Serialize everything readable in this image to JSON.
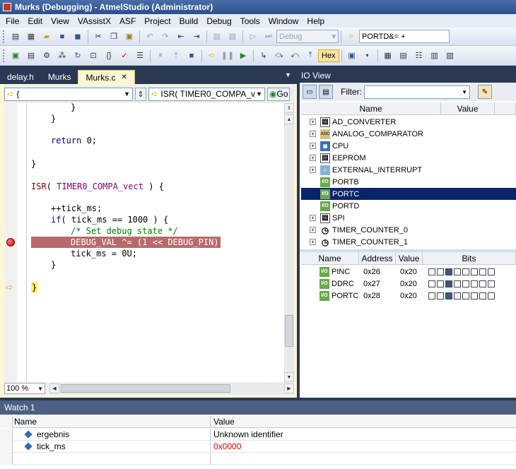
{
  "window": {
    "title": "Murks (Debugging) - AtmelStudio (Administrator)"
  },
  "menu": [
    "File",
    "Edit",
    "View",
    "VAssistX",
    "ASF",
    "Project",
    "Build",
    "Debug",
    "Tools",
    "Window",
    "Help"
  ],
  "toolbar1": {
    "config_combo": "Debug",
    "find_combo": "PORTD&= +"
  },
  "toolbar2": {
    "hex_label": "Hex"
  },
  "editor": {
    "tabs": [
      {
        "label": "delay.h"
      },
      {
        "label": "Murks"
      },
      {
        "label": "Murks.c"
      }
    ],
    "nav_scope": "{",
    "nav_member": "ISR( TIMER0_COMPA_v",
    "go_label": "Go",
    "zoom": "100 %",
    "code": {
      "l1": "}",
      "l2": "}",
      "l3_kw": "return",
      "l3_rest": " 0;",
      "l4": "}",
      "l5_fn": "ISR",
      "l5_p": "( ",
      "l5_mac": "TIMER0_COMPA_vect",
      "l5_rest": " ) {",
      "l6": "++tick_ms;",
      "l7_kw": "if",
      "l7_rest": "( tick_ms == 1000 ) {",
      "l8": "/* Set debug state */",
      "l9": "DEBUG_VAL ^= (1 << DEBUG_PIN);",
      "l10": "tick_ms = 0U;",
      "l11": "}",
      "l12": "}"
    }
  },
  "io_view": {
    "title": "IO View",
    "filter_label": "Filter:",
    "columns": {
      "name": "Name",
      "value": "Value"
    },
    "modules": [
      {
        "name": "AD_CONVERTER",
        "icon": "adc-icon",
        "expandable": true
      },
      {
        "name": "ANALOG_COMPARATOR",
        "icon": "analog-comparator-icon",
        "expandable": true
      },
      {
        "name": "CPU",
        "icon": "cpu-icon",
        "expandable": true
      },
      {
        "name": "EEPROM",
        "icon": "eeprom-icon",
        "expandable": true
      },
      {
        "name": "EXTERNAL_INTERRUPT",
        "icon": "interrupt-icon",
        "expandable": true
      },
      {
        "name": "PORTB",
        "icon": "io-port-icon",
        "expandable": false
      },
      {
        "name": "PORTC",
        "icon": "io-port-icon",
        "expandable": false,
        "selected": true
      },
      {
        "name": "PORTD",
        "icon": "io-port-icon",
        "expandable": false
      },
      {
        "name": "SPI",
        "icon": "spi-icon",
        "expandable": true
      },
      {
        "name": "TIMER_COUNTER_0",
        "icon": "timer-icon",
        "expandable": true
      },
      {
        "name": "TIMER_COUNTER_1",
        "icon": "timer-icon",
        "expandable": true
      }
    ],
    "io_badge": "I/O",
    "adc_badge": "ADC",
    "reg_columns": {
      "name": "Name",
      "address": "Address",
      "value": "Value",
      "bits": "Bits"
    },
    "registers": [
      {
        "name": "PINC",
        "address": "0x26",
        "value": "0x20",
        "bits": [
          0,
          0,
          1,
          0,
          0,
          0,
          0,
          0
        ]
      },
      {
        "name": "DDRC",
        "address": "0x27",
        "value": "0x20",
        "bits": [
          0,
          0,
          1,
          0,
          0,
          0,
          0,
          0
        ]
      },
      {
        "name": "PORTC",
        "address": "0x28",
        "value": "0x20",
        "bits": [
          0,
          0,
          1,
          0,
          0,
          0,
          0,
          0
        ]
      }
    ]
  },
  "watch": {
    "title": "Watch 1",
    "columns": {
      "name": "Name",
      "value": "Value"
    },
    "rows": [
      {
        "name": "ergebnis",
        "value": "Unknown identifier",
        "color": "#000000"
      },
      {
        "name": "tick_ms",
        "value": "0x0000",
        "color": "#e00000"
      }
    ]
  },
  "colors": {
    "accent": "#293955",
    "selection": "#0a246a",
    "breakpoint": "#b86a6a",
    "changed_value": "#e00000"
  }
}
